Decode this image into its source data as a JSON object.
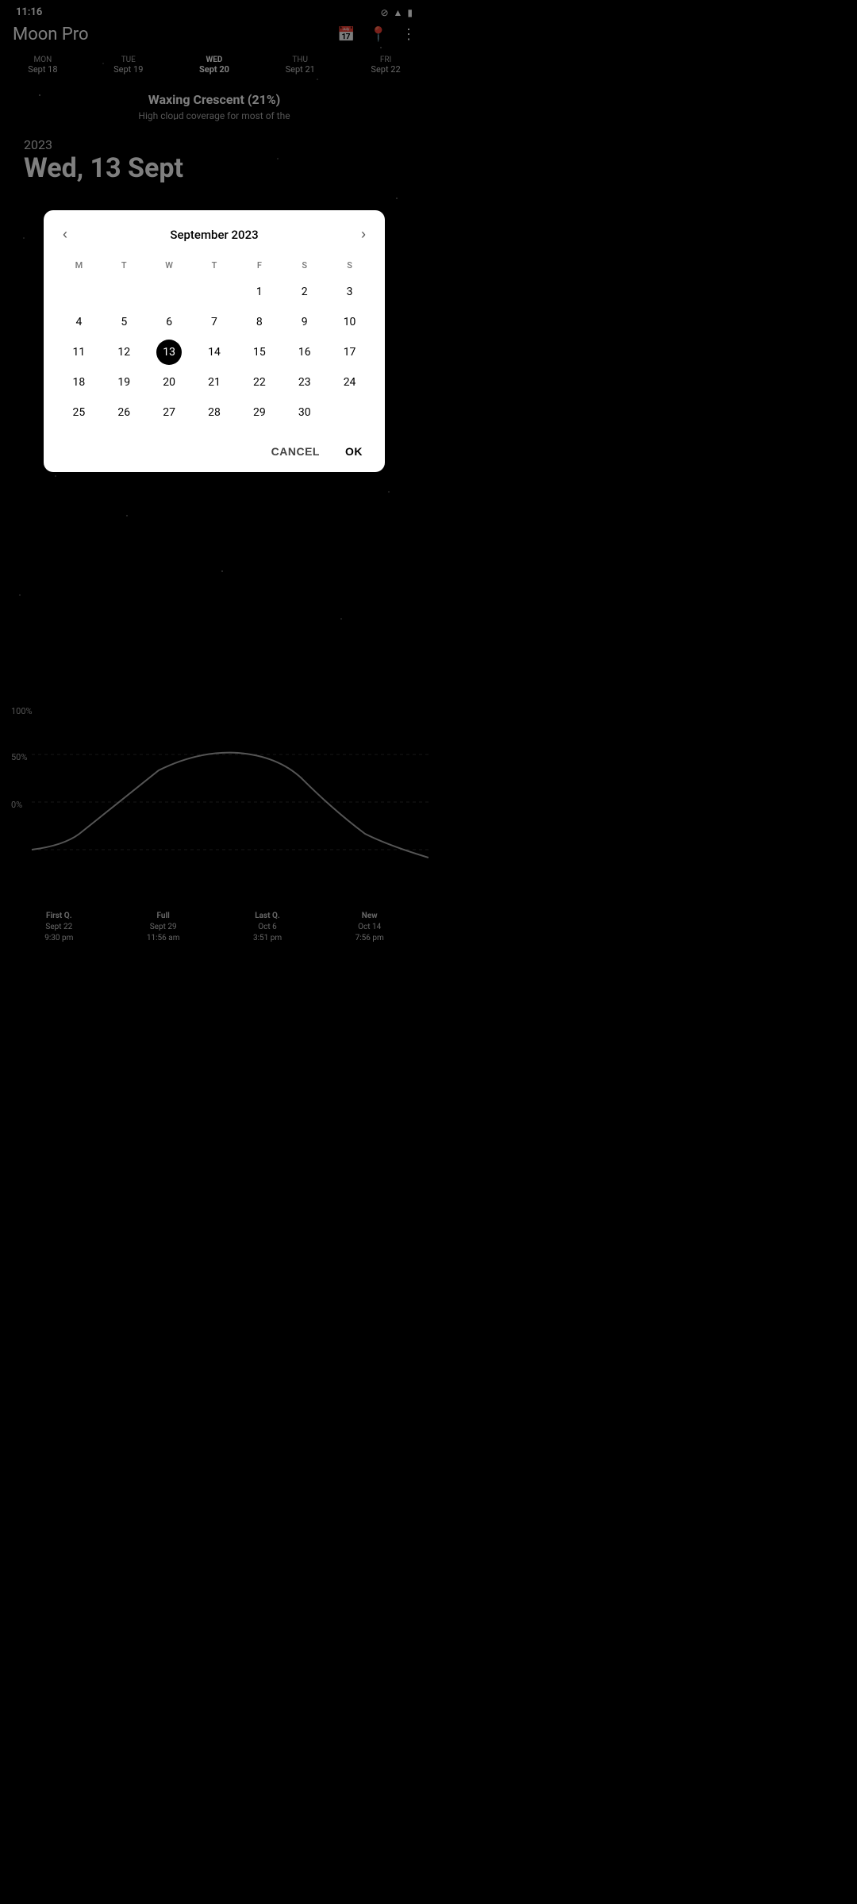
{
  "app": {
    "title": "Moon Pro"
  },
  "statusBar": {
    "time": "11:16",
    "icons": [
      "○",
      "▲",
      "▮"
    ]
  },
  "header": {
    "calendarIcon": "📅",
    "locationIcon": "📍",
    "moreIcon": "⋮"
  },
  "weekNav": {
    "days": [
      {
        "name": "MON",
        "date": "Sept 18",
        "active": false
      },
      {
        "name": "TUE",
        "date": "Sept 19",
        "active": false
      },
      {
        "name": "WED",
        "date": "Sept 20",
        "active": true
      },
      {
        "name": "THU",
        "date": "Sept 21",
        "active": false
      },
      {
        "name": "FRI",
        "date": "Sept 22",
        "active": false
      }
    ]
  },
  "moonInfo": {
    "phase": "Waxing Crescent (21%)",
    "coverage": "High cloud coverage for most of the"
  },
  "selectedDate": {
    "year": "2023",
    "fullDate": "Wed, 13 Sept"
  },
  "calendar": {
    "monthTitle": "September 2023",
    "daysOfWeek": [
      "M",
      "T",
      "W",
      "T",
      "F",
      "S",
      "S"
    ],
    "weeks": [
      [
        null,
        null,
        null,
        null,
        1,
        2,
        3
      ],
      [
        4,
        5,
        6,
        7,
        8,
        9,
        10
      ],
      [
        11,
        12,
        13,
        14,
        15,
        16,
        17
      ],
      [
        18,
        19,
        20,
        21,
        22,
        23,
        24
      ],
      [
        25,
        26,
        27,
        28,
        29,
        30,
        null
      ]
    ],
    "selectedDay": 13,
    "cancelLabel": "CANCEL",
    "okLabel": "OK"
  },
  "chartLabels": {
    "hundred": "100%",
    "fifty": "50%",
    "zero": "0%"
  },
  "moonPhases": [
    {
      "name": "First Q.",
      "date": "Sept 22",
      "time": "9:30 pm"
    },
    {
      "name": "Full",
      "date": "Sept 29",
      "time": "11:56 am"
    },
    {
      "name": "Last Q.",
      "date": "Oct 6",
      "time": "3:51 pm"
    },
    {
      "name": "New",
      "date": "Oct 14",
      "time": "7:56 pm"
    }
  ]
}
